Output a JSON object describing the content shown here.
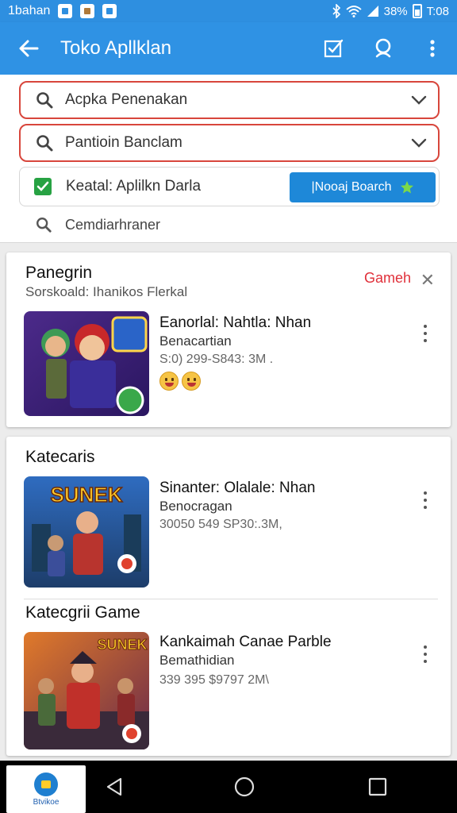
{
  "status_bar": {
    "left_text": "1bahan",
    "right_text": "38%",
    "time": "T:08"
  },
  "app_bar": {
    "title": "Toko Apllklan",
    "icons": [
      "back-arrow-icon",
      "checkbox-edit-icon",
      "search-person-icon",
      "more-vertical-icon"
    ]
  },
  "search": {
    "field1_label": "Acpka Penenakan",
    "field2_label": "Pantioin Banclam",
    "filter_label": "Keatal: Aplilkn Darla",
    "button_label": "|Nooaj Boarch",
    "suggestion": "Cemdiarhraner"
  },
  "card1": {
    "title": "Panegrin",
    "subtitle": "Sorskoald: Ihanikos Flerkal",
    "tag": "Gameh",
    "item": {
      "name": "Eanorlal: Nahtla: Nhan",
      "sub": "Benacartian",
      "meta": "S:0) 299-S843: 3M ."
    }
  },
  "card2": {
    "title": "Katecaris",
    "item1": {
      "thumb_text": "SUNEK",
      "name": "Sinanter: Olalale: Nhan",
      "sub": "Benocragan",
      "meta": "30050 549 SP30:.3M,"
    },
    "section2_title": "Katecgrii Game",
    "item2": {
      "thumb_text": "SUNEK",
      "name": "Kankaimah Canae Parble",
      "sub": "Bemathidian",
      "meta": "339 395 $9797 2M\\"
    }
  },
  "nav_bar": {
    "app_label": "Btvikoe"
  },
  "colors": {
    "primary": "#2f92e4",
    "field_border": "#d8463c",
    "check_green": "#27a243",
    "tag_red": "#e0303a"
  }
}
